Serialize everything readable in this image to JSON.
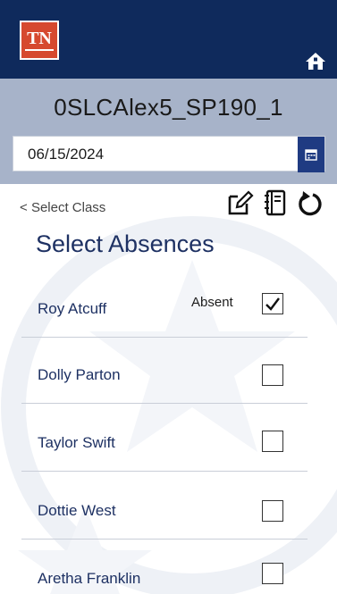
{
  "header": {
    "logo_text": "TN",
    "home_icon": "home-icon",
    "brand_color": "#0f2a5c"
  },
  "class_bar": {
    "class_name": "0SLCAlex5_SP190_1",
    "date_value": "06/15/2024",
    "calendar_icon": "calendar-icon"
  },
  "nav": {
    "back_label": "Select Class",
    "actions": [
      "edit-note-icon",
      "notebook-icon",
      "refresh-icon"
    ]
  },
  "page": {
    "title": "Select Absences"
  },
  "students": [
    {
      "name": "Roy Atcuff",
      "absent": true,
      "status_label": "Absent"
    },
    {
      "name": "Dolly Parton",
      "absent": false
    },
    {
      "name": "Taylor Swift",
      "absent": false
    },
    {
      "name": "Dottie West",
      "absent": false
    },
    {
      "name": "Aretha Franklin",
      "absent": false
    }
  ]
}
